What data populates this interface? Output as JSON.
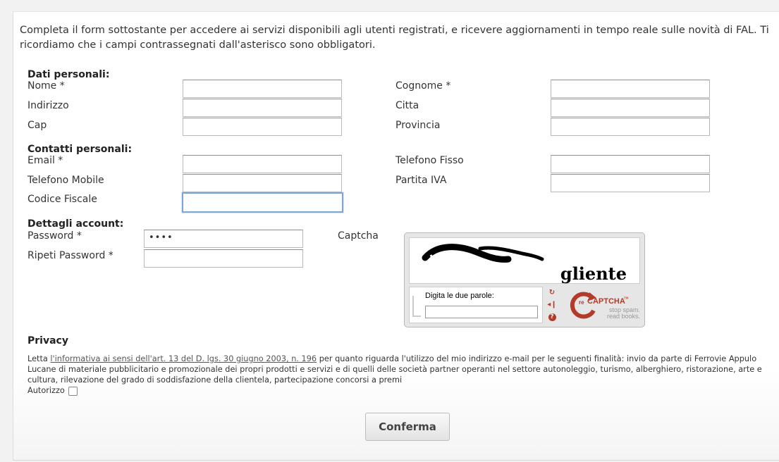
{
  "intro_text": "Completa il form sottostante per accedere ai servizi disponibili agli utenti registrati, e ricevere aggiornamenti in tempo reale sulle novità di FAL. Ti ricordiamo che i campi contrassegnati dall'asterisco sono obbligatori.",
  "sections": {
    "personal": "Dati personali:",
    "contacts": "Contatti personali:",
    "account": "Dettagli account:"
  },
  "fields": {
    "nome": {
      "label": "Nome *",
      "value": ""
    },
    "cognome": {
      "label": "Cognome *",
      "value": ""
    },
    "indirizzo": {
      "label": "Indirizzo",
      "value": ""
    },
    "citta": {
      "label": "Citta",
      "value": ""
    },
    "cap": {
      "label": "Cap",
      "value": ""
    },
    "provincia": {
      "label": "Provincia",
      "value": ""
    },
    "email": {
      "label": "Email *",
      "value": ""
    },
    "telefono_fisso": {
      "label": "Telefono Fisso",
      "value": ""
    },
    "telefono_mobile": {
      "label": "Telefono Mobile",
      "value": ""
    },
    "partita_iva": {
      "label": "Partita IVA",
      "value": ""
    },
    "codice_fiscale": {
      "label": "Codice Fiscale",
      "value": ""
    },
    "password": {
      "label": "Password *",
      "value": "••••"
    },
    "ripeti_password": {
      "label": "Ripeti Password *",
      "value": ""
    }
  },
  "captcha": {
    "label": "Captcha",
    "word1": "ngancha",
    "word2": "gliente",
    "prompt": "Digita le due parole:",
    "input_value": "",
    "brand_re": "re",
    "brand_name": "CAPTCHA",
    "brand_tm": "™",
    "tagline1": "stop spam.",
    "tagline2": "read books.",
    "accent_color": "#b23b2a"
  },
  "privacy": {
    "title": "Privacy",
    "prefix": "Letta ",
    "link_text": "l'informativa ai sensi dell'art. 13 del D. lgs. 30 giugno 2003, n. 196",
    "body": " per quanto riguarda l'utilizzo del mio indirizzo e-mail per le seguenti finalità: invio da parte di Ferrovie Appulo Lucane di materiale pubblicitario e promozionale dei propri prodotti e servizi e di quelli delle società partner operanti nel settore autonoleggio, turismo, alberghiero, ristorazione, arte e cultura, rilevazione del grado di soddisfazione della clientela, partecipazione concorsi a premi",
    "authorize_label": "Autorizzo"
  },
  "submit_label": "Conferma"
}
